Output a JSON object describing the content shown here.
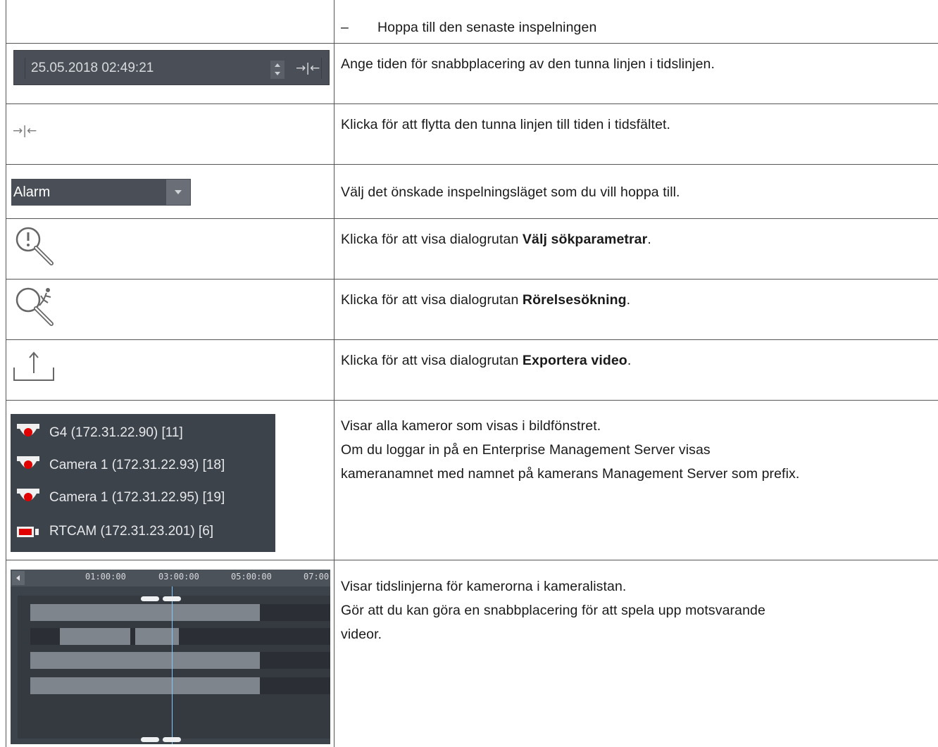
{
  "rows": [
    {
      "text": "Hoppa till den senaste inspelningen",
      "bullet": "–"
    },
    {
      "text": "Ange tiden för snabbplacering av den tunna linjen i tidslinjen."
    },
    {
      "text": "Klicka för att flytta den tunna linjen till tiden i tidsfältet."
    },
    {
      "text": "Välj det önskade inspelningsläget som du vill hoppa till."
    },
    {
      "text_pre": "Klicka för att visa dialogrutan ",
      "bold": "Välj sökparametrar",
      "text_post": "."
    },
    {
      "text_pre": "Klicka för att visa dialogrutan ",
      "bold": "Rörelsesökning",
      "text_post": "."
    },
    {
      "text_pre": "Klicka för att visa dialogrutan ",
      "bold": "Exportera video",
      "text_post": "."
    },
    {
      "line1": "Visar alla kameror som visas i bildfönstret.",
      "line2": "Om du loggar in på en Enterprise Management Server visas",
      "line3": "kameranamnet med namnet på kamerans Management Server som prefix."
    },
    {
      "line1": "Visar tidslinjerna för kamerorna i kameralistan.",
      "line2": "Gör att du kan göra en snabbplacering för att spela upp motsvarande",
      "line3": "videor."
    }
  ],
  "timefield": {
    "value": "25.05.2018 02:49:21",
    "jump_glyph": "→|←"
  },
  "jump_icon": "jump-to-time-icon",
  "dropdown": {
    "value": "Alarm"
  },
  "icons": [
    "alarm-search-icon",
    "motion-search-icon",
    "export-icon"
  ],
  "cameras": [
    {
      "name": "G4 (172.31.22.90) [11]",
      "icon": "dome-camera-icon"
    },
    {
      "name": "Camera 1 (172.31.22.93) [18]",
      "icon": "dome-camera-icon"
    },
    {
      "name": "Camera 1 (172.31.22.95) [19]",
      "icon": "dome-camera-icon"
    },
    {
      "name": "RTCAM (172.31.23.201) [6]",
      "icon": "box-camera-icon"
    }
  ],
  "timeline": {
    "ticks": [
      "01:00:00",
      "03:00:00",
      "05:00:00",
      "07:00"
    ]
  },
  "colors": {
    "widget_bg": "#4a4f57",
    "recording_dot": "#e00000",
    "cursor": "#7fc7ff"
  }
}
